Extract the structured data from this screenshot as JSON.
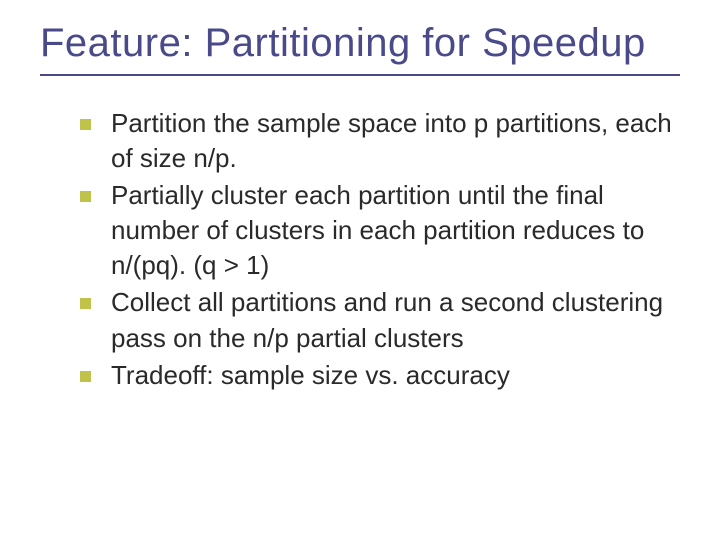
{
  "slide": {
    "title": "Feature:  Partitioning for Speedup",
    "bullets": [
      "Partition the sample space into p partitions, each of size n/p.",
      "Partially cluster each partition until the final number of clusters in each partition reduces to n/(pq). (q > 1)",
      "Collect all partitions and run a second clustering pass on the n/p partial clusters",
      "Tradeoff:  sample size vs. accuracy"
    ]
  }
}
